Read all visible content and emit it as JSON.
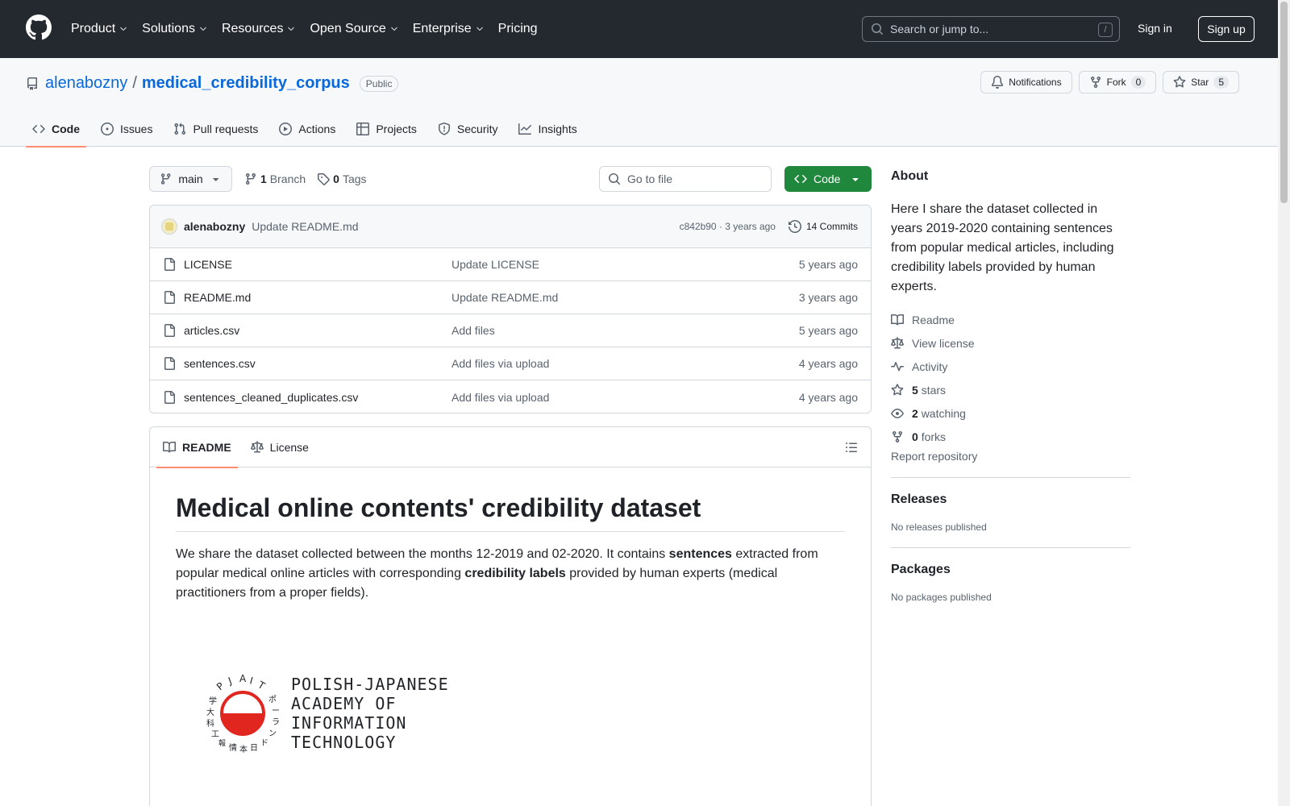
{
  "topnav": {
    "items": [
      {
        "label": "Product",
        "dropdown": true
      },
      {
        "label": "Solutions",
        "dropdown": true
      },
      {
        "label": "Resources",
        "dropdown": true
      },
      {
        "label": "Open Source",
        "dropdown": true
      },
      {
        "label": "Enterprise",
        "dropdown": true
      },
      {
        "label": "Pricing",
        "dropdown": false
      }
    ],
    "search_placeholder": "Search or jump to...",
    "search_shortcut": "/",
    "signin": "Sign in",
    "signup": "Sign up"
  },
  "repo": {
    "owner": "alenabozny",
    "separator": "/",
    "name": "medical_credibility_corpus",
    "visibility": "Public",
    "notifications_label": "Notifications",
    "fork_label": "Fork",
    "fork_count": "0",
    "star_label": "Star",
    "star_count": "5"
  },
  "tabs": [
    {
      "label": "Code",
      "icon": "code-icon"
    },
    {
      "label": "Issues",
      "icon": "issue-icon"
    },
    {
      "label": "Pull requests",
      "icon": "pull-request-icon"
    },
    {
      "label": "Actions",
      "icon": "play-icon"
    },
    {
      "label": "Projects",
      "icon": "table-icon"
    },
    {
      "label": "Security",
      "icon": "shield-icon"
    },
    {
      "label": "Insights",
      "icon": "graph-icon"
    }
  ],
  "filebar": {
    "branch": "main",
    "branch_count": "1",
    "branch_label": "Branch",
    "tag_count": "0",
    "tag_label": "Tags",
    "goto_placeholder": "Go to file",
    "code_button": "Code"
  },
  "commit": {
    "author": "alenabozny",
    "message": "Update README.md",
    "sha_time": "c842b90 · 3 years ago",
    "commits_label": "14 Commits"
  },
  "files": [
    {
      "name": "LICENSE",
      "message": "Update LICENSE",
      "age": "5 years ago"
    },
    {
      "name": "README.md",
      "message": "Update README.md",
      "age": "3 years ago"
    },
    {
      "name": "articles.csv",
      "message": "Add files",
      "age": "5 years ago"
    },
    {
      "name": "sentences.csv",
      "message": "Add files via upload",
      "age": "4 years ago"
    },
    {
      "name": "sentences_cleaned_duplicates.csv",
      "message": "Add files via upload",
      "age": "4 years ago"
    }
  ],
  "readme": {
    "tab_readme": "README",
    "tab_license": "License",
    "title": "Medical online contents' credibility dataset",
    "p_part1": "We share the dataset collected between the months 12-2019 and 02-2020. It contains ",
    "p_bold1": "sentences",
    "p_part2": " extracted from popular medical online articles with corresponding ",
    "p_bold2": "credibility labels",
    "p_part3": " provided by human experts (medical practitioners from a proper fields).",
    "logo_lines": [
      "POLISH-JAPANESE",
      "ACADEMY OF",
      "INFORMATION",
      "TECHNOLOGY"
    ],
    "logo_ring_text": "PJAIT",
    "logo_ring_glyphs": [
      "学",
      "大",
      "科",
      "工",
      "報",
      "情",
      "本",
      "日",
      "ド",
      "ン",
      "ラ",
      "ー",
      "ポ"
    ]
  },
  "sidebar": {
    "about_title": "About",
    "about_text": "Here I share the dataset collected in years 2019-2020 containing sentences from popular medical articles, including credibility labels provided by human experts.",
    "readme": "Readme",
    "license": "View license",
    "activity": "Activity",
    "stars_count": "5",
    "stars_label": "stars",
    "watching_count": "2",
    "watching_label": "watching",
    "forks_count": "0",
    "forks_label": "forks",
    "report": "Report repository",
    "releases_title": "Releases",
    "releases_text": "No releases published",
    "packages_title": "Packages",
    "packages_text": "No packages published"
  },
  "colors": {
    "header_bg": "#24292f",
    "link": "#0969da",
    "accent_underline": "#fd8c73",
    "code_button": "#1f883d",
    "logo_red": "#e0261f"
  }
}
